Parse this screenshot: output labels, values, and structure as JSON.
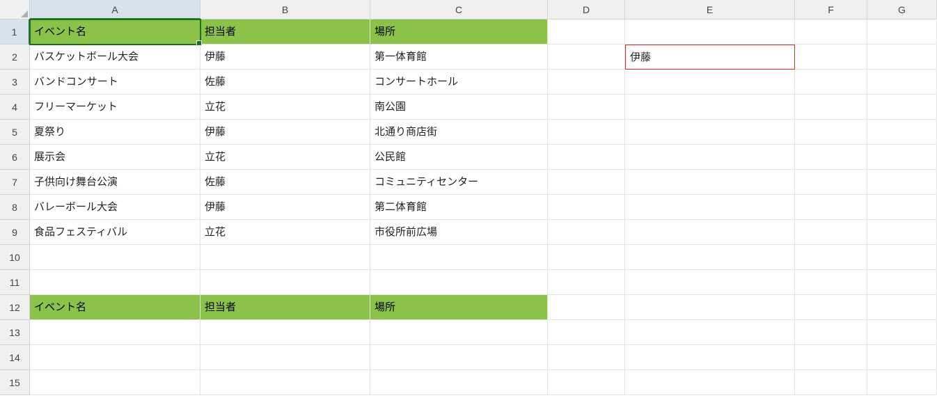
{
  "columns": [
    "A",
    "B",
    "C",
    "D",
    "E",
    "F",
    "G"
  ],
  "column_active_index": 0,
  "rows": [
    1,
    2,
    3,
    4,
    5,
    6,
    7,
    8,
    9,
    10,
    11,
    12,
    13,
    14,
    15
  ],
  "row_active_index": 0,
  "green_fill_rows": [
    1,
    12
  ],
  "selected_cell": "A1",
  "red_outline_cell": "E2",
  "cells": {
    "A1": "イベント名",
    "B1": "担当者",
    "C1": "場所",
    "A2": "バスケットボール大会",
    "B2": "伊藤",
    "C2": "第一体育館",
    "A3": "バンドコンサート",
    "B3": "佐藤",
    "C3": "コンサートホール",
    "A4": "フリーマーケット",
    "B4": "立花",
    "C4": "南公園",
    "A5": "夏祭り",
    "B5": "伊藤",
    "C5": "北通り商店街",
    "A6": "展示会",
    "B6": "立花",
    "C6": "公民館",
    "A7": "子供向け舞台公演",
    "B7": "佐藤",
    "C7": "コミュニティセンター",
    "A8": "バレーボール大会",
    "B8": "伊藤",
    "C8": "第二体育館",
    "A9": "食品フェスティバル",
    "B9": "立花",
    "C9": "市役所前広場",
    "A12": "イベント名",
    "B12": "担当者",
    "C12": "場所",
    "E2": "伊藤"
  }
}
